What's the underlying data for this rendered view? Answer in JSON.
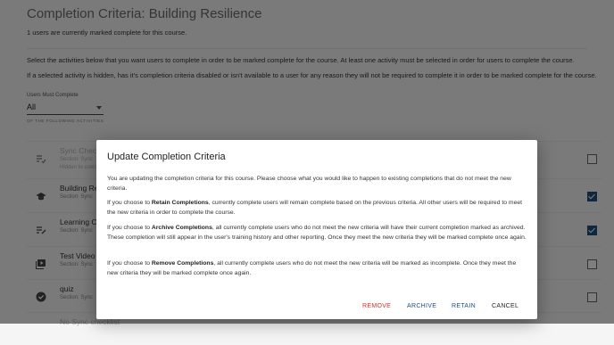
{
  "page": {
    "title": "Completion Criteria: Building Resilience",
    "completed_text": "1 users are currently marked complete for this course.",
    "instructions": "Select the activities below that you want users to complete in order to be marked complete for the course. At least one activity must be selected in order for users to complete the course.",
    "hidden_note": "If a selected activity is hidden, has it's completion criteria disabled or isn't available to a user for any reason they will not be required to complete it in order to be marked complete for the course.",
    "must_complete_label": "Users Must Complete",
    "must_complete_value": "All",
    "following_label": "OF THE FOLLOWING ACTIVITIES"
  },
  "activities": [
    {
      "title": "Sync Check",
      "subtitle": "Section: Sync",
      "note": "Hidden to users",
      "checked": false,
      "icon": "checklist-icon"
    },
    {
      "title": "Building Re",
      "subtitle": "Section: Sync",
      "note": "",
      "checked": true,
      "icon": "graduation-cap-icon"
    },
    {
      "title": "Learning C",
      "subtitle": "Section: Sync",
      "note": "",
      "checked": true,
      "icon": "edit-list-icon"
    },
    {
      "title": "Test Video",
      "subtitle": "Section: Sync",
      "note": "",
      "checked": false,
      "icon": "video-icon"
    },
    {
      "title": "quiz",
      "subtitle": "Section: Sync",
      "note": "",
      "checked": false,
      "icon": "check-circle-icon"
    },
    {
      "title": "No Sync checklist",
      "subtitle": "",
      "note": "",
      "checked": false,
      "icon": "checklist-icon"
    }
  ],
  "colors": {
    "checkbox_checked": "#1e4f7e",
    "remove_button": "#d32f2f",
    "archive_button": "#1e4f7e",
    "retain_button": "#1e4f7e",
    "cancel_button": "#222222"
  },
  "dialog": {
    "title": "Update Completion Criteria",
    "intro": "You are updating the completion criteria for this course. Please choose what you would like to happen to existing completions that do not meet the new criteria.",
    "retain_prefix": "If you choose to ",
    "retain_bold": "Retain Completions",
    "retain_text": ", currently complete users will remain complete based on the previous criteria. All other users will be required to meet the new criteria in order to complete the course.",
    "archive_prefix": "If you choose to ",
    "archive_bold": "Archive Completions",
    "archive_text": ", all currently complete users who do not meet the new criteria will have their current completion marked as archived. These completion will still appear in the user's training history and other reporting. Once they meet the new criteria they will be marked complete once again.",
    "remove_prefix": "If you choose to ",
    "remove_bold": "Remove Completions",
    "remove_text": ", all currently complete users who do not meet the new criteria will be marked as incomplete. Once they meet the new criteria they will be marked complete once again.",
    "buttons": {
      "remove": "REMOVE",
      "archive": "ARCHIVE",
      "retain": "RETAIN",
      "cancel": "CANCEL"
    }
  }
}
